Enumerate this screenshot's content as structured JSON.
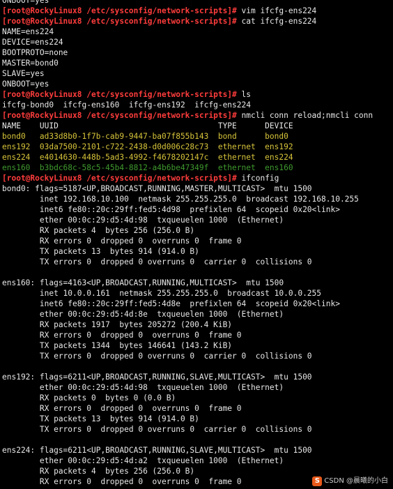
{
  "terminal": {
    "lines": [
      {
        "t": "ONBOOT=yes"
      },
      {
        "p": "[root@RockyLinux8 /etc/sysconfig/network-scripts]# ",
        "t": "vim ifcfg-ens224"
      },
      {
        "p": "[root@RockyLinux8 /etc/sysconfig/network-scripts]# ",
        "t": "cat ifcfg-ens224"
      },
      {
        "t": "NAME=ens224"
      },
      {
        "t": "DEVICE=ens224"
      },
      {
        "t": "BOOTPROTO=none"
      },
      {
        "t": "MASTER=bond0"
      },
      {
        "t": "SLAVE=yes"
      },
      {
        "t": "ONBOOT=yes"
      },
      {
        "p": "[root@RockyLinux8 /etc/sysconfig/network-scripts]# ",
        "t": "ls"
      },
      {
        "t": "ifcfg-bond0  ifcfg-ens160  ifcfg-ens192  ifcfg-ens224"
      },
      {
        "p": "[root@RockyLinux8 /etc/sysconfig/network-scripts]# ",
        "t": "nmcli conn reload;nmcli conn"
      },
      {
        "t": "NAME    UUID                                  TYPE      DEVICE"
      },
      {
        "t": "bond0   ad33d8b0-1f7b-cab9-9447-ba07f855b143  bond      bond0",
        "c": "yellow"
      },
      {
        "t": "ens192  03da7500-2101-c722-2438-d0d006c28c73  ethernet  ens192",
        "c": "yellow"
      },
      {
        "t": "ens224  e4014630-448b-5ad3-4992-f4678202147c  ethernet  ens224",
        "c": "yellow"
      },
      {
        "t": "ens160  b3bdc68c-58c5-45b4-8812-a4b6be47349f  ethernet  ens160",
        "c": "green"
      },
      {
        "p": "[root@RockyLinux8 /etc/sysconfig/network-scripts]# ",
        "t": "ifconfig"
      },
      {
        "t": "bond0: flags=5187<UP,BROADCAST,RUNNING,MASTER,MULTICAST>  mtu 1500"
      },
      {
        "t": "        inet 192.168.10.100  netmask 255.255.255.0  broadcast 192.168.10.255"
      },
      {
        "t": "        inet6 fe80::20c:29ff:fed5:4d98  prefixlen 64  scopeid 0x20<link>"
      },
      {
        "t": "        ether 00:0c:29:d5:4d:98  txqueuelen 1000  (Ethernet)"
      },
      {
        "t": "        RX packets 4  bytes 256 (256.0 B)"
      },
      {
        "t": "        RX errors 0  dropped 0  overruns 0  frame 0"
      },
      {
        "t": "        TX packets 13  bytes 914 (914.0 B)"
      },
      {
        "t": "        TX errors 0  dropped 0 overruns 0  carrier 0  collisions 0"
      },
      {
        "t": ""
      },
      {
        "t": "ens160: flags=4163<UP,BROADCAST,RUNNING,MULTICAST>  mtu 1500"
      },
      {
        "t": "        inet 10.0.0.161  netmask 255.255.255.0  broadcast 10.0.0.255"
      },
      {
        "t": "        inet6 fe80::20c:29ff:fed5:4d8e  prefixlen 64  scopeid 0x20<link>"
      },
      {
        "t": "        ether 00:0c:29:d5:4d:8e  txqueuelen 1000  (Ethernet)"
      },
      {
        "t": "        RX packets 1917  bytes 205272 (200.4 KiB)"
      },
      {
        "t": "        RX errors 0  dropped 0  overruns 0  frame 0"
      },
      {
        "t": "        TX packets 1344  bytes 146641 (143.2 KiB)"
      },
      {
        "t": "        TX errors 0  dropped 0 overruns 0  carrier 0  collisions 0"
      },
      {
        "t": ""
      },
      {
        "t": "ens192: flags=6211<UP,BROADCAST,RUNNING,SLAVE,MULTICAST>  mtu 1500"
      },
      {
        "t": "        ether 00:0c:29:d5:4d:98  txqueuelen 1000  (Ethernet)"
      },
      {
        "t": "        RX packets 0  bytes 0 (0.0 B)"
      },
      {
        "t": "        RX errors 0  dropped 0  overruns 0  frame 0"
      },
      {
        "t": "        TX packets 13  bytes 914 (914.0 B)"
      },
      {
        "t": "        TX errors 0  dropped 0 overruns 0  carrier 0  collisions 0"
      },
      {
        "t": ""
      },
      {
        "t": "ens224: flags=6211<UP,BROADCAST,RUNNING,SLAVE,MULTICAST>  mtu 1500"
      },
      {
        "t": "        ether 00:0c:29:d5:4d:a2  txqueuelen 1000  (Ethernet)"
      },
      {
        "t": "        RX packets 4  bytes 256 (256.0 B)"
      },
      {
        "t": "        RX errors 0  dropped 0  overruns 0  frame 0"
      }
    ]
  },
  "watermark": {
    "logo_text": "S",
    "text": "CSDN @晨曦的小白"
  },
  "colors": {
    "prompt": "#ff3c3c",
    "active_connection": "#d7c43a",
    "inactive_connection": "#3f9a2e",
    "background": "#000000",
    "foreground": "#e8e8e8"
  }
}
